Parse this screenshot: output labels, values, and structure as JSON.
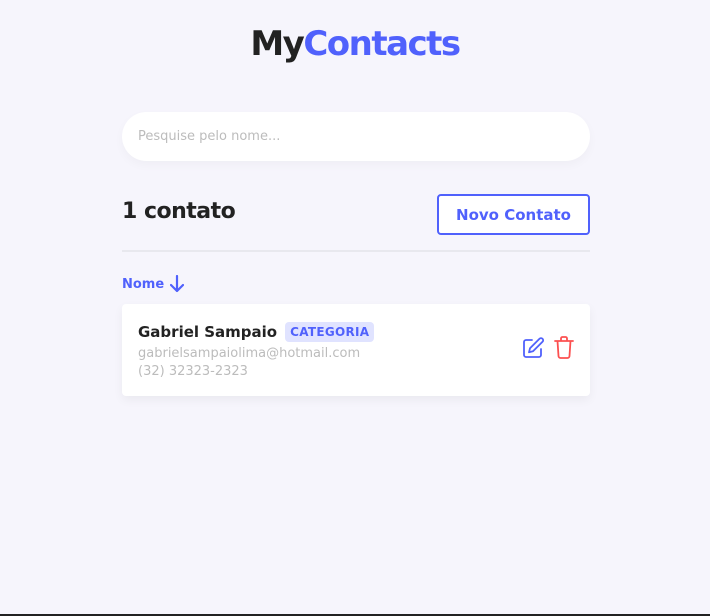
{
  "app": {
    "logo_part_a": "My",
    "logo_part_b": "Contacts"
  },
  "search": {
    "placeholder": "Pesquise pelo nome...",
    "value": ""
  },
  "header": {
    "count_label": "1 contato",
    "new_contact_label": "Novo Contato"
  },
  "list": {
    "sort_label": "Nome",
    "sort_icon": "arrow-down-icon",
    "contacts": [
      {
        "name": "Gabriel Sampaio",
        "category": "CATEGORIA",
        "email": "gabrielsampaiolima@hotmail.com",
        "phone": "(32) 32323-2323",
        "edit_icon": "edit-icon",
        "delete_icon": "trash-icon"
      }
    ]
  },
  "colors": {
    "primary": "#5061fc",
    "danger": "#fc5050",
    "background": "#f6f5fc",
    "text": "#222222",
    "muted": "#bcbcbc",
    "badge_bg": "#e0e3ff"
  }
}
